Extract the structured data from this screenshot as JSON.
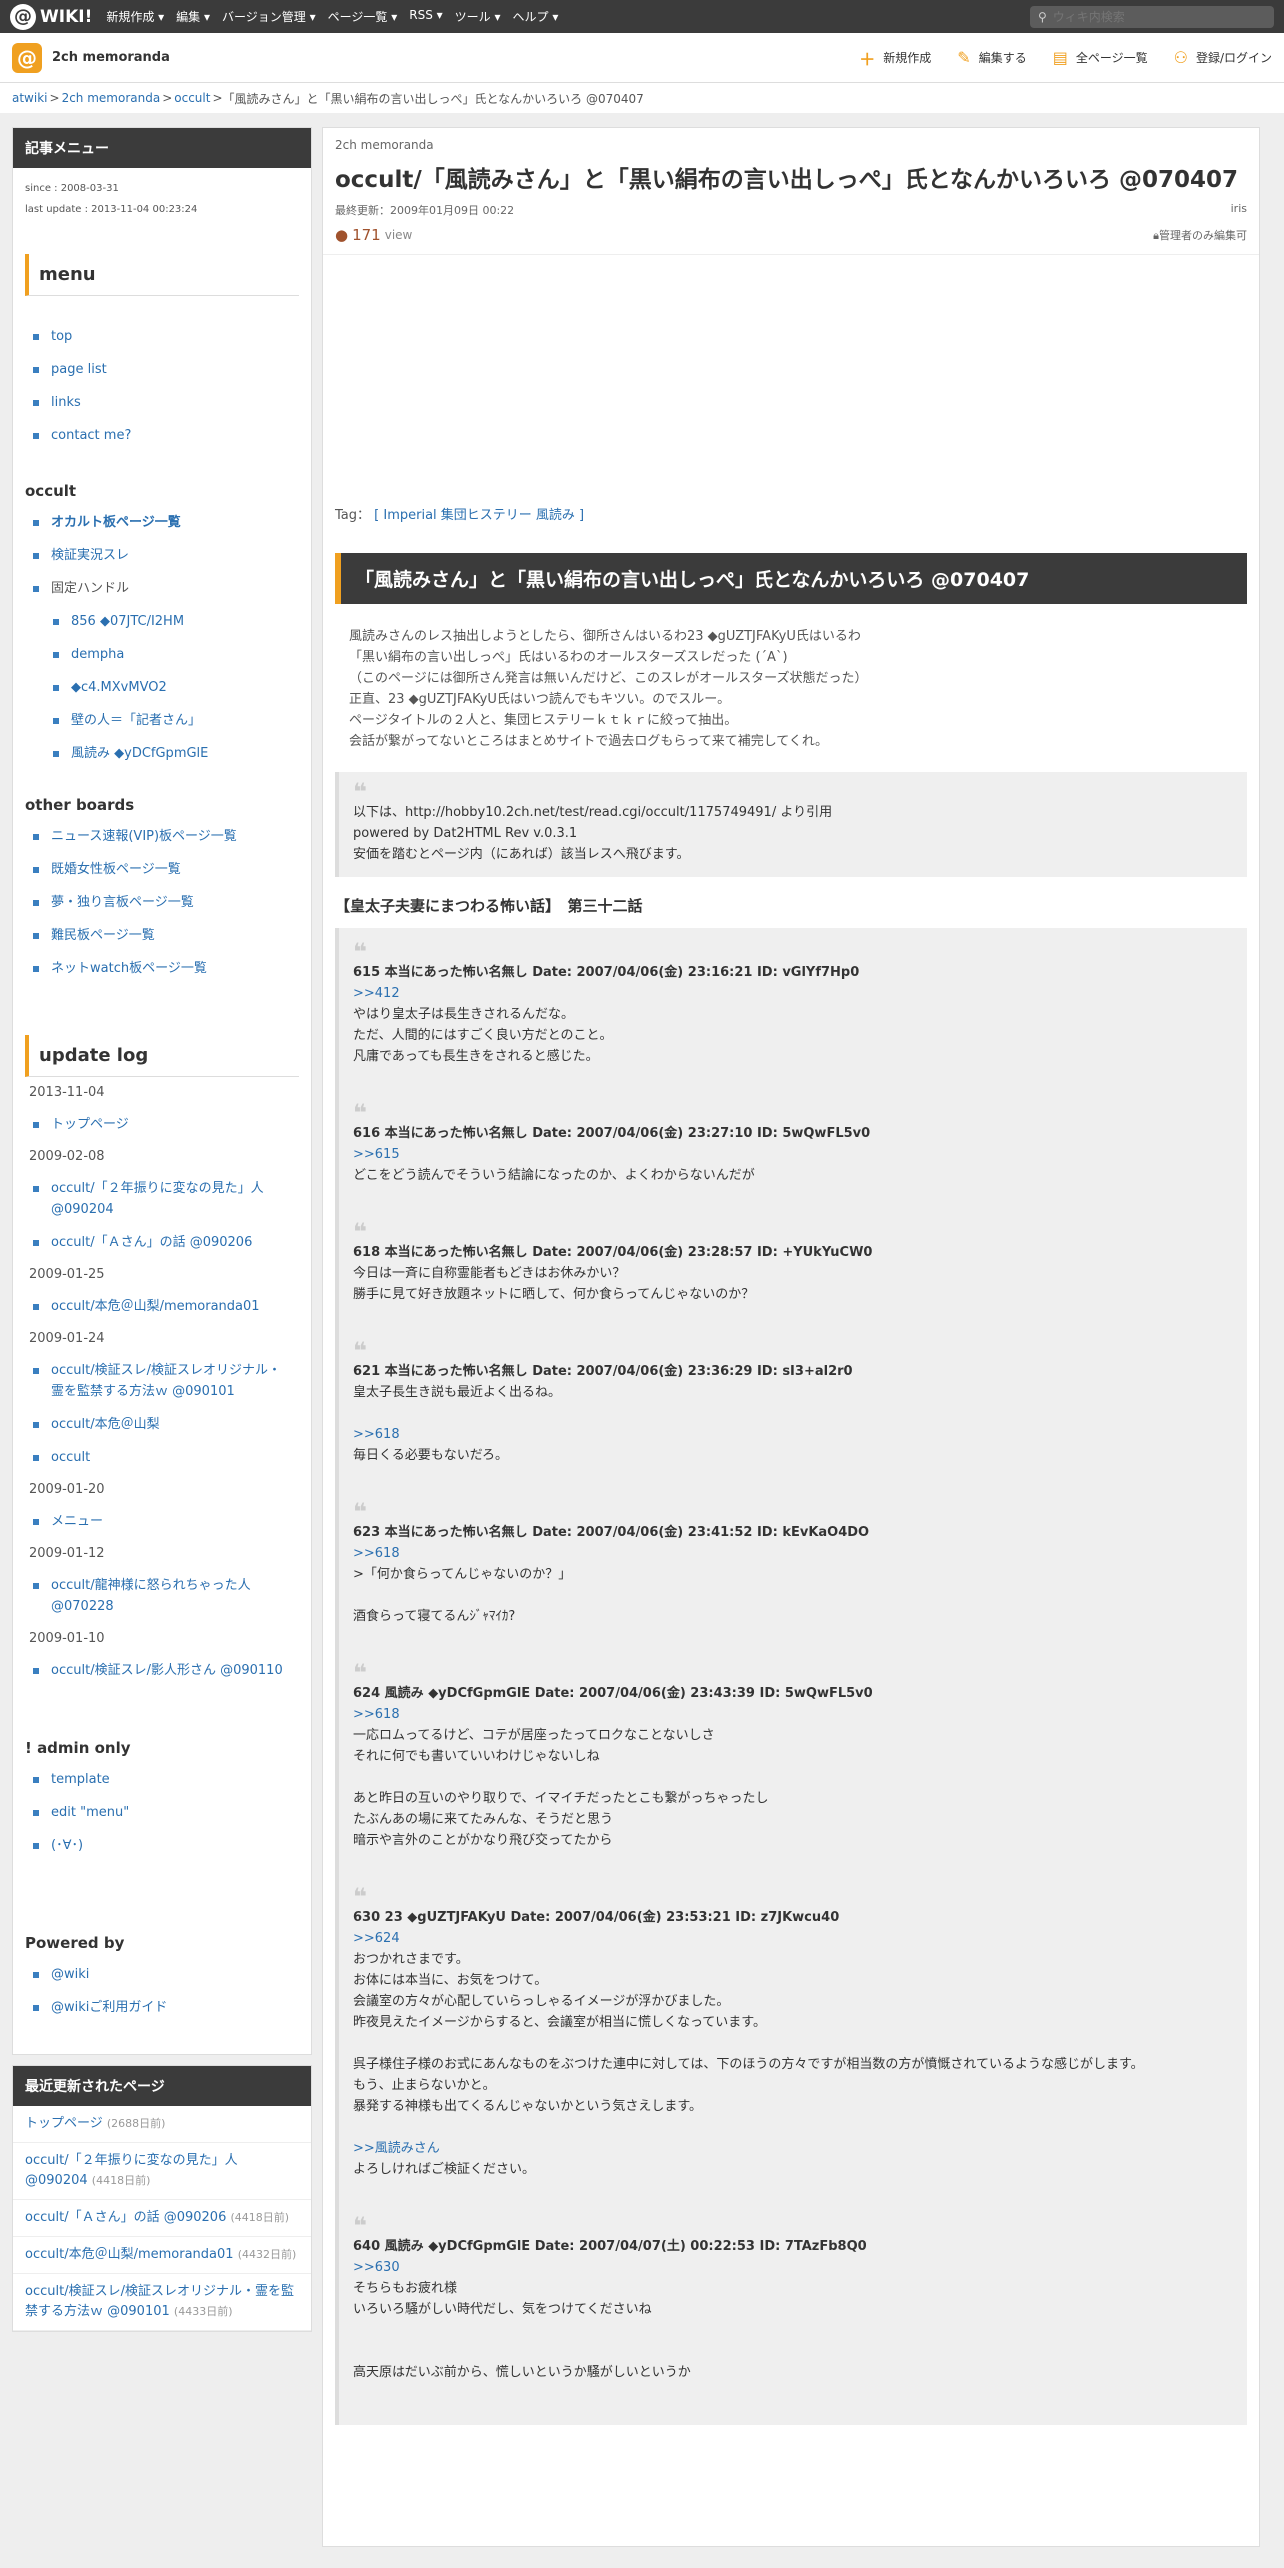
{
  "topbar": {
    "logo": "WIKI!",
    "menu": [
      "新規作成 ▾",
      "編集 ▾",
      "バージョン管理 ▾",
      "ページ一覧 ▾",
      "RSS ▾",
      "ツール ▾",
      "ヘルプ ▾"
    ],
    "search_placeholder": "ウィキ内検索"
  },
  "site": {
    "name": "2ch memoranda",
    "actions": [
      "新規作成",
      "編集する",
      "全ページ一覧",
      "登録/ログイン"
    ]
  },
  "breadcrumb": [
    "atwiki",
    "2ch memoranda",
    "occult",
    "「風読みさん」と「黒い絹布の言い出しっぺ」氏となんかいろいろ @070407"
  ],
  "sidebar": {
    "header": "記事メニュー",
    "since": "since : 2008-03-31",
    "last_update": "last update : 2013-11-04 00:23:24",
    "menu_title": "menu",
    "menu": [
      "top",
      "page list",
      "links",
      "contact me?"
    ],
    "occult_title": "occult",
    "occult": [
      "オカルト板ページ一覧",
      "検証実況スレ",
      "固定ハンドル"
    ],
    "handles": [
      "856 ◆07JTC/I2HM",
      "dempha",
      "◆c4.MXvMVO2",
      "壁の人＝「記者さん」",
      "風読み ◆yDCfGpmGlE"
    ],
    "other_title": "other boards",
    "other": [
      "ニュース速報(VIP)板ページ一覧",
      "既婚女性板ページ一覧",
      "夢・独り言板ページ一覧",
      "難民板ページ一覧",
      "ネットwatch板ページ一覧"
    ],
    "update_title": "update log",
    "updates": [
      {
        "date": "2013-11-04",
        "items": [
          "トップページ"
        ]
      },
      {
        "date": "2009-02-08",
        "items": [
          "occult/「２年振りに変なの見た」人 @090204",
          "occult/「Ａさん」の話 @090206"
        ]
      },
      {
        "date": "2009-01-25",
        "items": [
          "occult/本危＠山梨/memoranda01"
        ]
      },
      {
        "date": "2009-01-24",
        "items": [
          "occult/検証スレ/検証スレオリジナル・霊を監禁する方法ｗ @090101",
          "occult/本危＠山梨",
          "occult"
        ]
      },
      {
        "date": "2009-01-20",
        "items": [
          "メニュー"
        ]
      },
      {
        "date": "2009-01-12",
        "items": [
          "occult/龍神様に怒られちゃった人 @070228"
        ]
      },
      {
        "date": "2009-01-10",
        "items": [
          "occult/検証スレ/影人形さん @090110"
        ]
      }
    ],
    "admin_title": "! admin only",
    "admin": [
      "template",
      "edit \"menu\"",
      "(･∀･)"
    ],
    "powered_title": "Powered by",
    "powered": [
      "@wiki",
      "@wikiご利用ガイド"
    ],
    "recent_header": "最近更新されたページ",
    "recent": [
      {
        "t": "トップページ",
        "d": "(2688日前)"
      },
      {
        "t": "occult/「２年振りに変なの見た」人 @090204",
        "d": "(4418日前)"
      },
      {
        "t": "occult/「Ａさん」の話 @090206",
        "d": "(4418日前)"
      },
      {
        "t": "occult/本危＠山梨/memoranda01",
        "d": "(4432日前)"
      },
      {
        "t": "occult/検証スレ/検証スレオリジナル・霊を監禁する方法ｗ @090101",
        "d": "(4433日前)"
      }
    ]
  },
  "main": {
    "crumb": "2ch memoranda",
    "title": "occult/「風読みさん」と「黒い絹布の言い出しっぺ」氏となんかいろいろ @070407",
    "updated": "最終更新：2009年01月09日 00:22",
    "author": "iris",
    "views": "171",
    "views_label": "view",
    "admin_edit": "管理者のみ編集可",
    "tag_label": "Tag：",
    "tags": "[ Imperial 集団ヒステリー 風読み ]",
    "h2": "「風読みさん」と「黒い絹布の言い出しっぺ」氏となんかいろいろ @070407",
    "intro": [
      "風読みさんのレス抽出しようとしたら、御所さんはいるわ23 ◆gUZTJFAKyU氏はいるわ",
      "「黒い絹布の言い出しっぺ」氏はいるわのオールスターズスレだった (´A`)",
      "（このページには御所さん発言は無いんだけど、このスレがオールスターズ状態だった）",
      "正直、23 ◆gUZTJFAKyU氏はいつ読んでもキツい。のでスルー。",
      "ページタイトルの２人と、集団ヒステリーｋｔｋｒに絞って抽出。",
      "会話が繋がってないところはまとめサイトで過去ログもらって来て補完してくれ。"
    ],
    "quote": [
      "以下は、http://hobby10.2ch.net/test/read.cgi/occult/1175749491/ より引用",
      "powered by Dat2HTML Rev v.0.3.1",
      "安価を踏むとページ内（にあれば）該当レスへ飛びます。"
    ],
    "section": "【皇太子夫妻にまつわる怖い話】　第三十二話",
    "responses": [
      {
        "head": "615 本当にあった怖い名無し Date: 2007/04/06(金) 23:16:21 ID: vGlYf7Hp0",
        "body": [
          ">>412",
          "やはり皇太子は長生きされるんだな。",
          "ただ、人間的にはすごく良い方だとのこと。",
          "凡庸であっても長生きをされると感じた。"
        ]
      },
      {
        "head": "616 本当にあった怖い名無し Date: 2007/04/06(金) 23:27:10 ID: 5wQwFL5v0",
        "body": [
          ">>615",
          "どこをどう読んでそういう結論になったのか、よくわからないんだが"
        ]
      },
      {
        "head": "618 本当にあった怖い名無し Date: 2007/04/06(金) 23:28:57 ID: +YUkYuCW0",
        "body": [
          "今日は一斉に自称霊能者もどきはお休みかい？",
          "勝手に見て好き放題ネットに晒して、何か食らってんじゃないのか？"
        ]
      },
      {
        "head": "621 本当にあった怖い名無し Date: 2007/04/06(金) 23:36:29 ID: sI3+al2r0",
        "body": [
          "皇太子長生き説も最近よく出るね。",
          "",
          ">>618",
          "毎日くる必要もないだろ。"
        ]
      },
      {
        "head": "623 本当にあった怖い名無し Date: 2007/04/06(金) 23:41:52 ID: kEvKaO4DO",
        "body": [
          ">>618",
          ">「何か食らってんじゃないのか？」",
          "",
          "酒食らって寝てるんｼﾞｬﾏｲｶ?"
        ]
      },
      {
        "head": "624 風読み ◆yDCfGpmGlE Date: 2007/04/06(金) 23:43:39 ID: 5wQwFL5v0",
        "body": [
          ">>618",
          "一応ロムってるけど、コテが居座ったってロクなことないしさ",
          "それに何でも書いていいわけじゃないしね",
          "",
          "あと昨日の互いのやり取りで、イマイチだったとこも繋がっちゃったし",
          "たぶんあの場に来てたみんな、そうだと思う",
          "暗示や言外のことがかなり飛び交ってたから"
        ]
      },
      {
        "head": "630 23 ◆gUZTJFAKyU Date: 2007/04/06(金) 23:53:21 ID: z7JKwcu40",
        "body": [
          ">>624",
          "おつかれさまです。",
          "お体には本当に、お気をつけて。",
          "会議室の方々が心配していらっしゃるイメージが浮かびました。",
          "昨夜見えたイメージからすると、会議室が相当に慌しくなっています。",
          "",
          "呉子様住子様のお式にあんなものをぶつけた連中に対しては、下のほうの方々ですが相当数の方が憤慨されているような感じがします。",
          "もう、止まらないかと。",
          "暴発する神様も出てくるんじゃないかという気さえします。",
          "",
          ">>風読みさん",
          "よろしければご検証ください。"
        ]
      },
      {
        "head": "640 風読み ◆yDCfGpmGlE Date: 2007/04/07(土) 00:22:53 ID: 7TAzFb8Q0",
        "body": [
          ">>630",
          "そちらもお疲れ様",
          "いろいろ騒がしい時代だし、気をつけてくださいね",
          "",
          "",
          "高天原はだいぶ前から、慌しいというか騒がしいというか"
        ]
      }
    ]
  }
}
